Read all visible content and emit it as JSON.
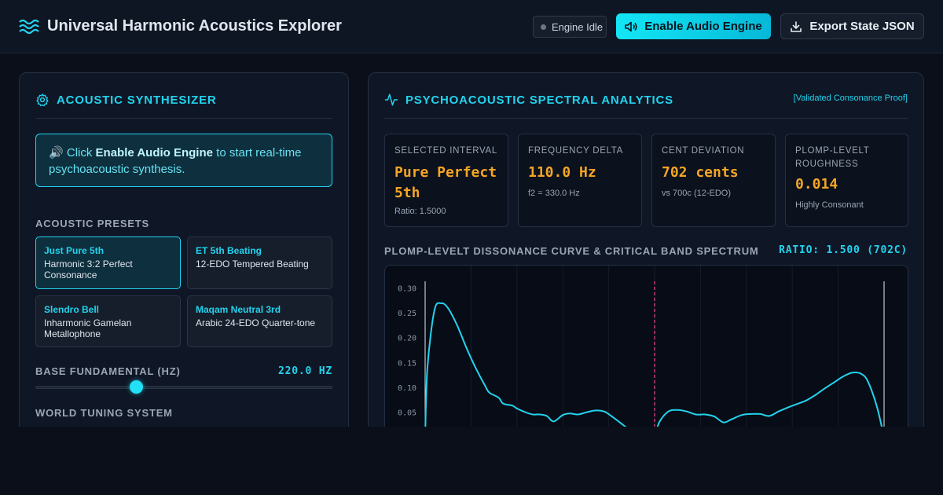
{
  "header": {
    "title": "Universal Harmonic Acoustics Explorer",
    "status": "Engine Idle",
    "enable_label": "Enable Audio Engine",
    "export_label": "Export State JSON"
  },
  "synth": {
    "title": "ACOUSTIC SYNTHESIZER",
    "info_icon": "🔊",
    "info_pre": "Click",
    "info_bold": "Enable Audio Engine",
    "info_post": "to start real-time psychoacoustic synthesis.",
    "presets_label": "ACOUSTIC PRESETS",
    "presets": [
      {
        "name": "Just Pure 5th",
        "desc": "Harmonic 3:2 Perfect Consonance"
      },
      {
        "name": "ET 5th Beating",
        "desc": "12-EDO Tempered Beating"
      },
      {
        "name": "Slendro Bell",
        "desc": "Inharmonic Gamelan Metallophone"
      },
      {
        "name": "Maqam Neutral 3rd",
        "desc": "Arabic 24-EDO Quarter-tone"
      }
    ],
    "fundamental_label": "BASE FUNDAMENTAL (HZ)",
    "fundamental_value": "220.0 HZ",
    "fundamental_slider_fraction": 0.34,
    "tuning_label": "WORLD TUNING SYSTEM"
  },
  "analytics": {
    "title": "PSYCHOACOUSTIC SPECTRAL ANALYTICS",
    "proof": "[Validated Consonance Proof]",
    "metrics": [
      {
        "label": "SELECTED INTERVAL",
        "value": "Pure Perfect 5th",
        "sub": "Ratio: 1.5000"
      },
      {
        "label": "FREQUENCY DELTA",
        "value": "110.0 Hz",
        "sub": "f2 = 330.0 Hz"
      },
      {
        "label": "CENT DEVIATION",
        "value": "702 cents",
        "sub": "vs 700c (12-EDO)"
      },
      {
        "label": "PLOMP-LEVELT ROUGHNESS",
        "value": "0.014",
        "sub": "Highly Consonant"
      }
    ],
    "chart_label": "PLOMP-LEVELT DISSONANCE CURVE & CRITICAL BAND SPECTRUM",
    "chart_ratio": "RATIO: 1.500 (702C)"
  },
  "colors": {
    "accent": "#22d3ee",
    "value": "#f5a524",
    "marker": "#e0457b"
  },
  "chart_data": {
    "type": "line",
    "yticks": [
      "0.30",
      "0.25",
      "0.20",
      "0.15",
      "0.10",
      "0.05"
    ],
    "ylim": [
      0,
      0.31
    ],
    "xlim": [
      1.0,
      2.0
    ],
    "selected_ratio": 1.5,
    "grid": true,
    "series": [
      {
        "x": [
          1.0,
          1.005,
          1.02,
          1.035,
          1.05,
          1.07,
          1.09,
          1.11,
          1.13,
          1.14,
          1.16,
          1.17,
          1.19,
          1.2,
          1.22,
          1.235,
          1.25,
          1.265,
          1.28,
          1.3,
          1.315,
          1.333,
          1.35,
          1.37,
          1.39,
          1.41,
          1.43,
          1.45,
          1.47,
          1.49,
          1.5,
          1.51,
          1.53,
          1.55,
          1.57,
          1.59,
          1.61,
          1.63,
          1.65,
          1.667,
          1.69,
          1.71,
          1.73,
          1.75,
          1.77,
          1.79,
          1.81,
          1.83,
          1.85,
          1.87,
          1.89,
          1.91,
          1.93,
          1.95,
          1.965,
          1.985,
          2.0
        ],
        "y": [
          0.0,
          0.14,
          0.255,
          0.27,
          0.26,
          0.225,
          0.18,
          0.14,
          0.105,
          0.09,
          0.08,
          0.068,
          0.064,
          0.058,
          0.05,
          0.046,
          0.046,
          0.043,
          0.032,
          0.045,
          0.048,
          0.046,
          0.05,
          0.054,
          0.052,
          0.04,
          0.026,
          0.012,
          0.004,
          0.002,
          0.0,
          0.03,
          0.052,
          0.055,
          0.052,
          0.046,
          0.046,
          0.042,
          0.03,
          0.036,
          0.045,
          0.047,
          0.047,
          0.043,
          0.052,
          0.06,
          0.067,
          0.074,
          0.085,
          0.098,
          0.11,
          0.122,
          0.13,
          0.128,
          0.112,
          0.06,
          0.0
        ]
      }
    ]
  }
}
